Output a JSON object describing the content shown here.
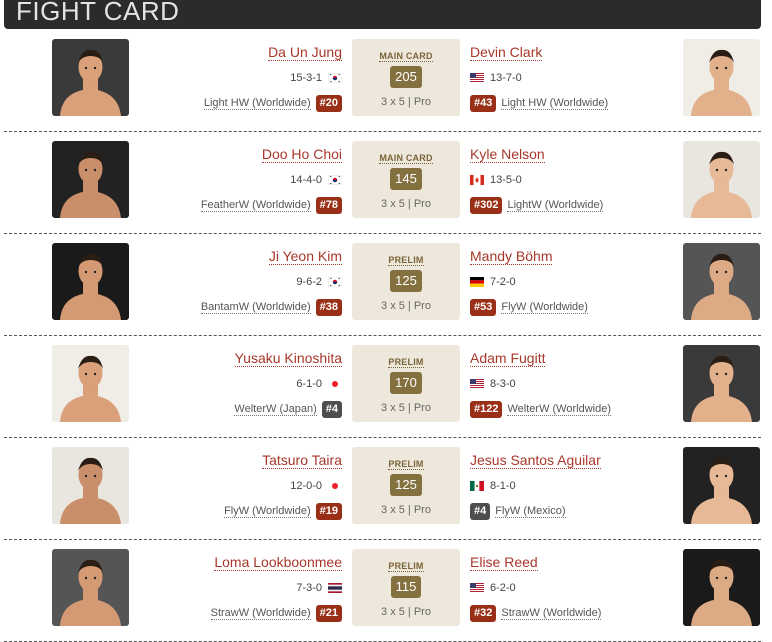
{
  "header": {
    "title": "FIGHT CARD"
  },
  "fights": [
    {
      "card": "MAIN CARD",
      "weight": "205",
      "rounds": "3 x 5  |  Pro",
      "left": {
        "name": "Da Un Jung",
        "record": "15-3-1",
        "flag": "kr",
        "wclass": "Light HW (Worldwide)",
        "rank": "#20",
        "rank_style": "red"
      },
      "right": {
        "name": "Devin Clark",
        "record": "13-7-0",
        "flag": "us",
        "wclass": "Light HW (Worldwide)",
        "rank": "#43",
        "rank_style": "red"
      }
    },
    {
      "card": "MAIN CARD",
      "weight": "145",
      "rounds": "3 x 5  |  Pro",
      "left": {
        "name": "Doo Ho Choi",
        "record": "14-4-0",
        "flag": "kr",
        "wclass": "FeatherW (Worldwide)",
        "rank": "#78",
        "rank_style": "red"
      },
      "right": {
        "name": "Kyle Nelson",
        "record": "13-5-0",
        "flag": "ca",
        "wclass": "LightW (Worldwide)",
        "rank": "#302",
        "rank_style": "red"
      }
    },
    {
      "card": "PRELIM",
      "weight": "125",
      "rounds": "3 x 5  |  Pro",
      "left": {
        "name": "Ji Yeon Kim",
        "record": "9-6-2",
        "flag": "kr",
        "wclass": "BantamW (Worldwide)",
        "rank": "#38",
        "rank_style": "red"
      },
      "right": {
        "name": "Mandy Böhm",
        "record": "7-2-0",
        "flag": "de",
        "wclass": "FlyW (Worldwide)",
        "rank": "#53",
        "rank_style": "red"
      }
    },
    {
      "card": "PRELIM",
      "weight": "170",
      "rounds": "3 x 5  |  Pro",
      "left": {
        "name": "Yusaku Kinoshita",
        "record": "6-1-0",
        "flag": "jp",
        "wclass": "WelterW (Japan)",
        "rank": "#4",
        "rank_style": "gray"
      },
      "right": {
        "name": "Adam Fugitt",
        "record": "8-3-0",
        "flag": "us",
        "wclass": "WelterW (Worldwide)",
        "rank": "#122",
        "rank_style": "red"
      }
    },
    {
      "card": "PRELIM",
      "weight": "125",
      "rounds": "3 x 5  |  Pro",
      "left": {
        "name": "Tatsuro Taira",
        "record": "12-0-0",
        "flag": "jp",
        "wclass": "FlyW (Worldwide)",
        "rank": "#19",
        "rank_style": "red"
      },
      "right": {
        "name": "Jesus Santos Aguilar",
        "record": "8-1-0",
        "flag": "mx",
        "wclass": "FlyW (Mexico)",
        "rank": "#4",
        "rank_style": "gray"
      }
    },
    {
      "card": "PRELIM",
      "weight": "115",
      "rounds": "3 x 5  |  Pro",
      "left": {
        "name": "Loma Lookboonmee",
        "record": "7-3-0",
        "flag": "th",
        "wclass": "StrawW (Worldwide)",
        "rank": "#21",
        "rank_style": "red"
      },
      "right": {
        "name": "Elise Reed",
        "record": "6-2-0",
        "flag": "us",
        "wclass": "StrawW (Worldwide)",
        "rank": "#32",
        "rank_style": "red"
      }
    }
  ],
  "colors": {
    "name": "#a8372a",
    "rank_red": "#9a2f17",
    "rank_gray": "#4d4d4d",
    "center_bg": "#ede8db",
    "weight_badge": "#85703f",
    "header_bg": "#2b2b2b"
  }
}
